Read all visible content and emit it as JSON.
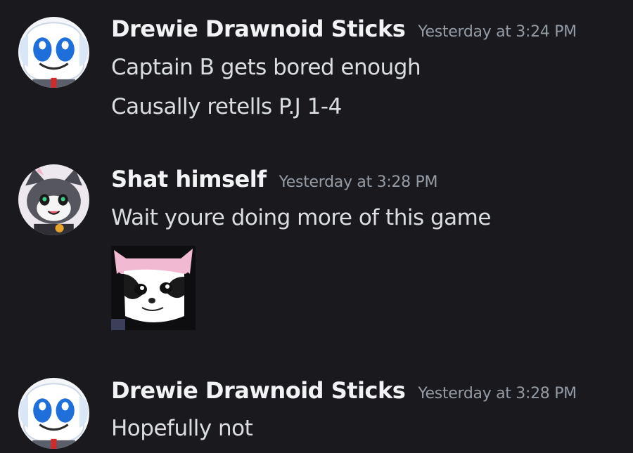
{
  "messages": [
    {
      "author": "Drewie Drawnoid Sticks",
      "timestamp": "Yesterday at 3:24 PM",
      "avatar": "blue-eyed-white-character-avatar",
      "lines": [
        "Captain B gets bored enough",
        "Causally retells P.J 1-4"
      ]
    },
    {
      "author": "Shat himself",
      "timestamp": "Yesterday at 3:28 PM",
      "avatar": "grey-cat-character-avatar",
      "lines": [
        "Wait youre doing more of this game"
      ],
      "attachment": "cat-with-pink-hat-sticker"
    },
    {
      "author": "Drewie Drawnoid Sticks",
      "timestamp": "Yesterday at 3:28 PM",
      "avatar": "blue-eyed-white-character-avatar",
      "lines": [
        "Hopefully not"
      ]
    }
  ],
  "colors": {
    "background": "#1a1a1e",
    "username": "#f2f3f5",
    "timestamp": "#949ba4",
    "message_text": "#dbdee1"
  }
}
